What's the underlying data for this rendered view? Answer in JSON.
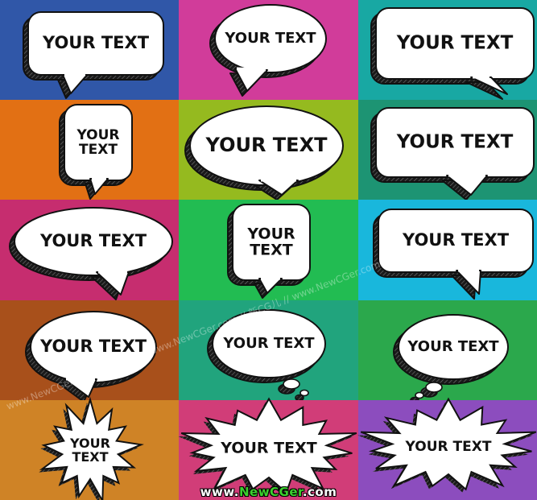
{
  "bubble_text": "YOUR TEXT",
  "bubble_text_stacked": [
    "YOUR",
    "TEXT"
  ],
  "watermark": {
    "diagonal": "www.NewCGer.com // 新CG儿 // www.NewCGer.com // 新CG儿 // www.NewCGer.com // 新CG儿",
    "footer_prefix": "www.",
    "footer_brand": "NewCGer",
    "footer_suffix": ".com"
  },
  "cells": [
    {
      "bg": "#3057a8",
      "shape": "rounded-rect",
      "text_layout": "single"
    },
    {
      "bg": "#d13c9a",
      "shape": "oval",
      "text_layout": "single"
    },
    {
      "bg": "#18a8a3",
      "shape": "rounded-rect",
      "text_layout": "single"
    },
    {
      "bg": "#e27014",
      "shape": "rounded-rect",
      "text_layout": "stacked"
    },
    {
      "bg": "#95ba1f",
      "shape": "oval",
      "text_layout": "single"
    },
    {
      "bg": "#1d9473",
      "shape": "rounded-rect",
      "text_layout": "single"
    },
    {
      "bg": "#c62d6f",
      "shape": "oval",
      "text_layout": "single"
    },
    {
      "bg": "#22bc52",
      "shape": "rounded-rect",
      "text_layout": "stacked"
    },
    {
      "bg": "#19b7dc",
      "shape": "rounded-rect",
      "text_layout": "single"
    },
    {
      "bg": "#a8501b",
      "shape": "oval",
      "text_layout": "single"
    },
    {
      "bg": "#21a47d",
      "shape": "thought",
      "text_layout": "single"
    },
    {
      "bg": "#2ba84c",
      "shape": "thought",
      "text_layout": "single"
    },
    {
      "bg": "#cf8326",
      "shape": "burst",
      "text_layout": "stacked"
    },
    {
      "bg": "#d13d78",
      "shape": "burst",
      "text_layout": "single"
    },
    {
      "bg": "#8c4dbe",
      "shape": "burst",
      "text_layout": "single"
    }
  ]
}
